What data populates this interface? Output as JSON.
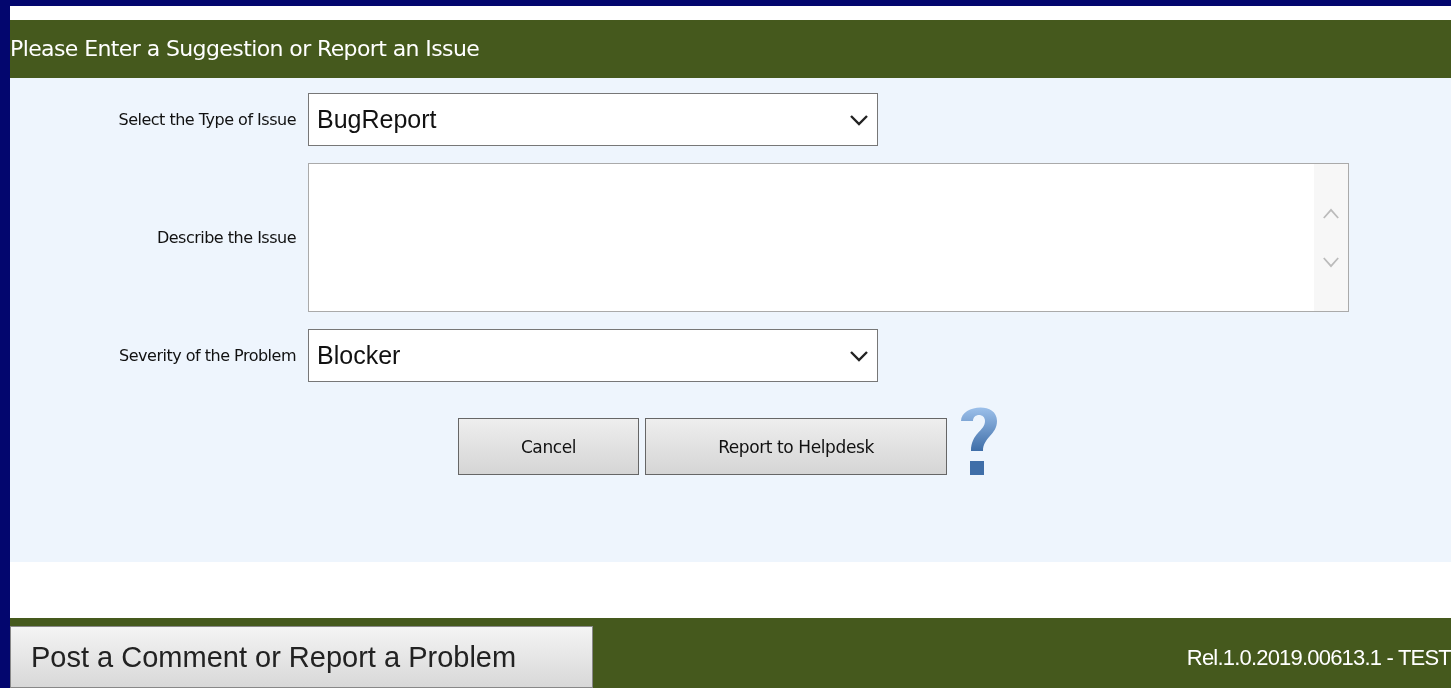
{
  "panel": {
    "title": "Please Enter a Suggestion or Report an Issue"
  },
  "fields": [
    {
      "kind": "select",
      "label": "Select the Type of Issue",
      "value": "BugReport"
    },
    {
      "kind": "textarea",
      "label": "Describe the Issue"
    },
    {
      "kind": "select",
      "label": "Severity of the Problem",
      "value": "Blocker"
    }
  ],
  "buttons": [
    "Cancel",
    "Report to Helpdesk"
  ],
  "footer": {
    "button": "Post a Comment or Report a Problem",
    "version": "Rel.1.0.2019.00613.1 - TEST"
  }
}
